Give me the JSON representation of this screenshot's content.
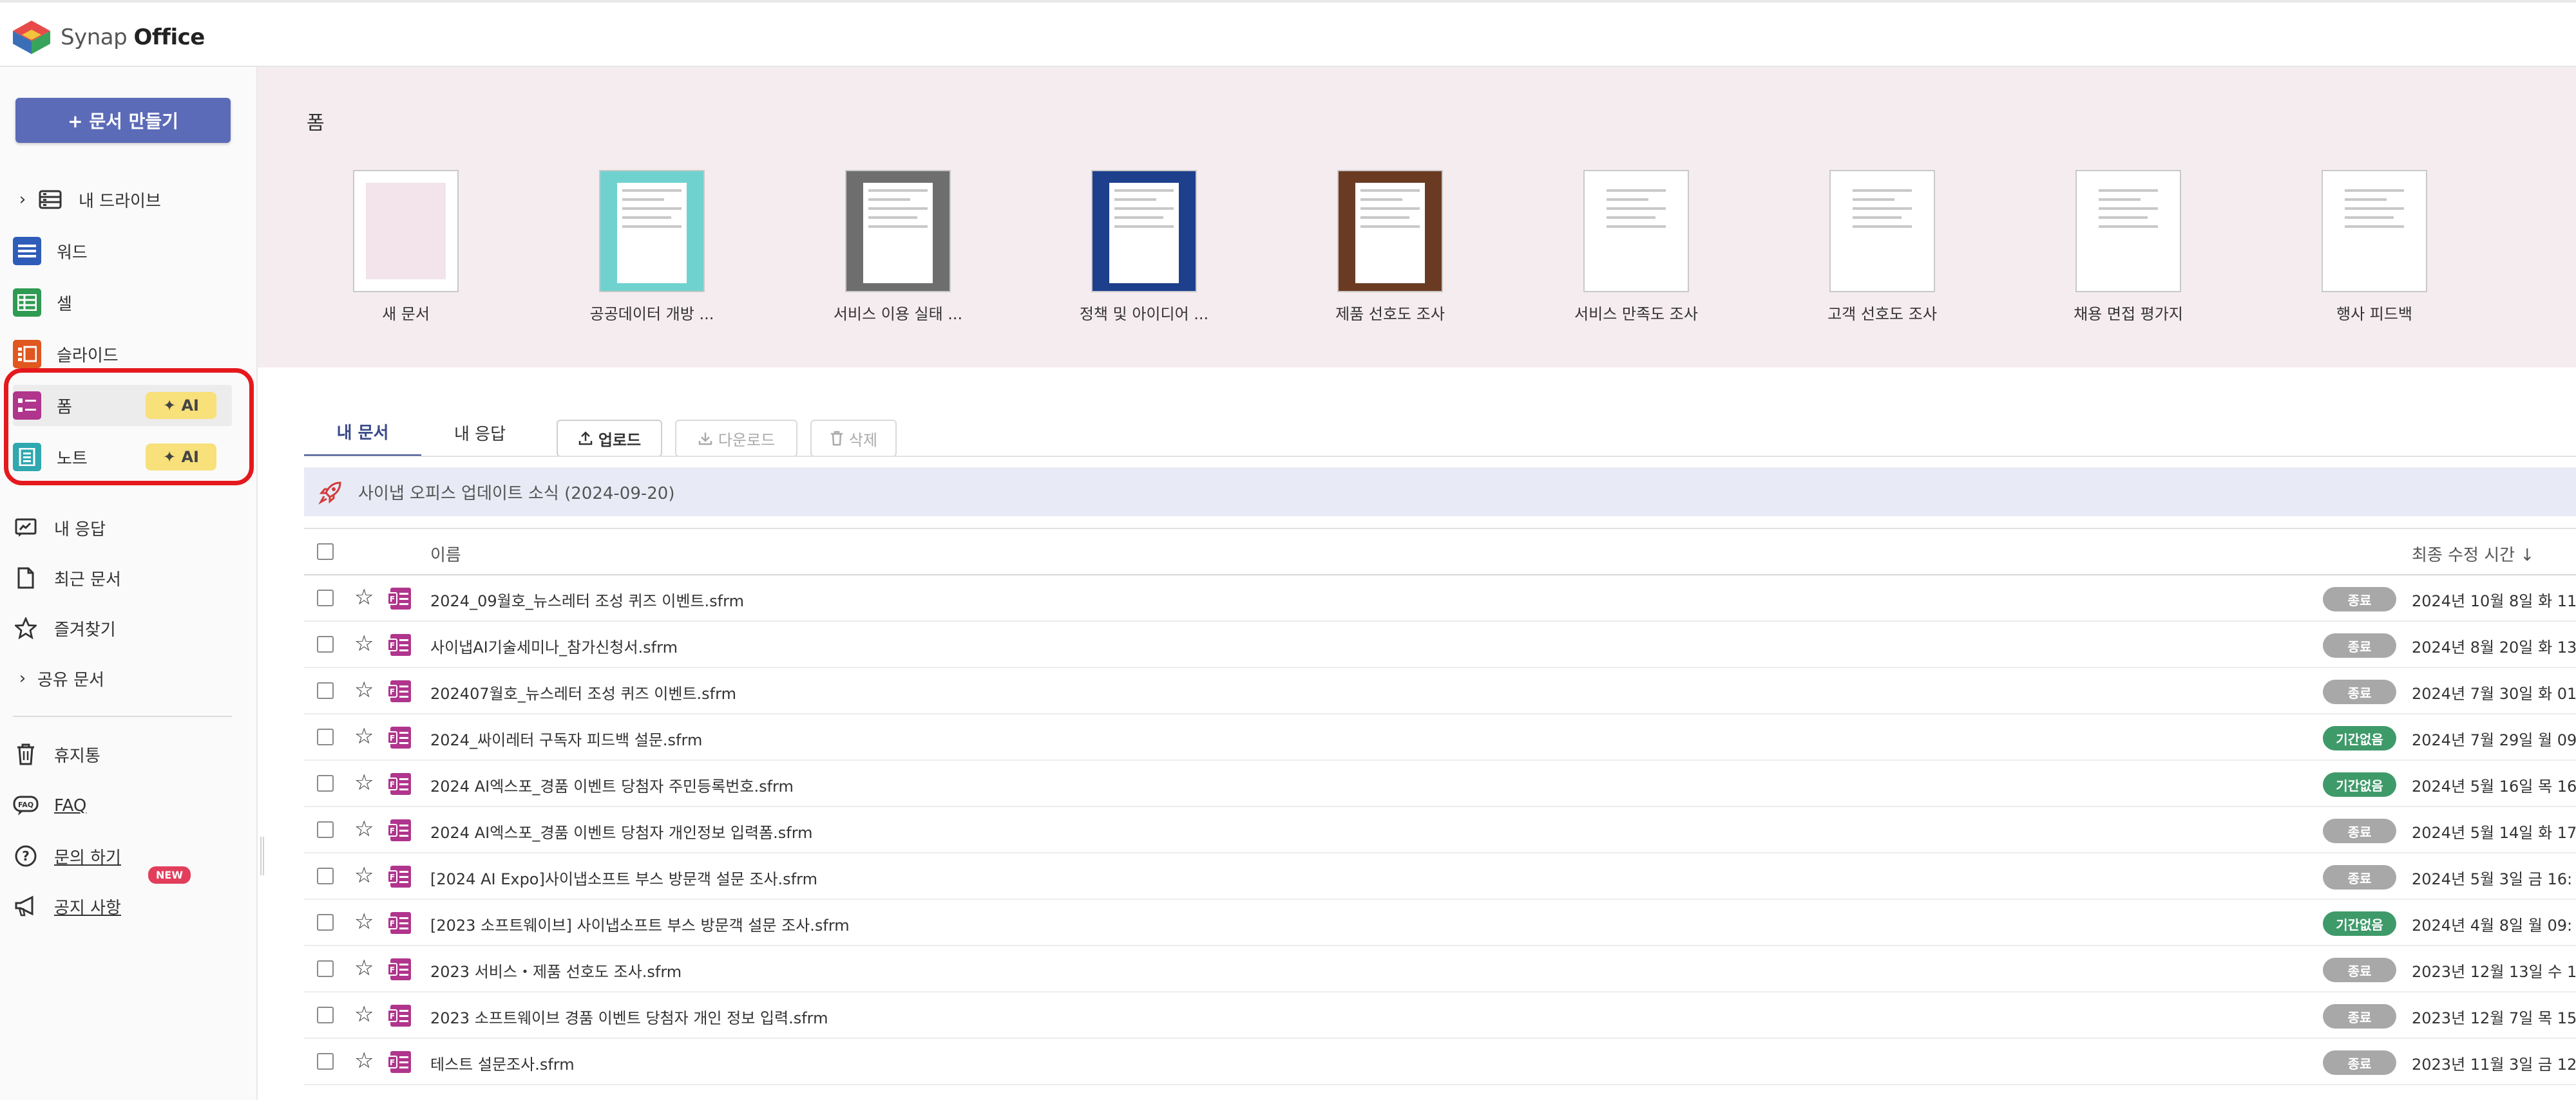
{
  "app": {
    "brand_light": "Synap ",
    "brand_bold": "Office"
  },
  "sidebar": {
    "create_label": "+ 문서 만들기",
    "items": [
      {
        "label": "내 드라이브"
      },
      {
        "label": "워드"
      },
      {
        "label": "셀"
      },
      {
        "label": "슬라이드"
      },
      {
        "label": "폼",
        "badge": "AI"
      },
      {
        "label": "노트",
        "badge": "AI"
      },
      {
        "label": "내 응답"
      },
      {
        "label": "최근 문서"
      },
      {
        "label": "즐겨찾기"
      },
      {
        "label": "공유 문서"
      },
      {
        "label": "휴지통"
      },
      {
        "label": "FAQ"
      },
      {
        "label": "문의 하기"
      },
      {
        "label": "공지 사항",
        "badge": "NEW"
      }
    ]
  },
  "templates": {
    "title": "폼",
    "items": [
      {
        "label": "새 문서"
      },
      {
        "label": "공공데이터 개방 ..."
      },
      {
        "label": "서비스 이용 실태 ..."
      },
      {
        "label": "정책 및 아이디어 ..."
      },
      {
        "label": "제품 선호도 조사"
      },
      {
        "label": "서비스 만족도 조사"
      },
      {
        "label": "고객 선호도 조사"
      },
      {
        "label": "채용 면접 평가지"
      },
      {
        "label": "행사 피드백"
      }
    ]
  },
  "tabs": [
    {
      "label": "내 문서"
    },
    {
      "label": "내 응답"
    }
  ],
  "toolbar": {
    "upload": "업로드",
    "download": "다운로드",
    "delete": "삭제"
  },
  "notice": {
    "text": "사이냅 오피스 업데이트 소식 (2024-09-20)"
  },
  "table": {
    "col_name": "이름",
    "col_time": "최종 수정 시간 ↓",
    "rows": [
      {
        "name": "2024_09월호_뉴스레터 조성 퀴즈 이벤트.sfrm",
        "status": "종료",
        "time": "2024년 10월 8일 화 11"
      },
      {
        "name": "사이냅AI기술세미나_참가신청서.sfrm",
        "status": "종료",
        "time": "2024년 8월 20일 화 13"
      },
      {
        "name": "202407월호_뉴스레터 조성 퀴즈 이벤트.sfrm",
        "status": "종료",
        "time": "2024년 7월 30일 화 01"
      },
      {
        "name": "2024_싸이레터 구독자 피드백 설문.sfrm",
        "status": "기간없음",
        "time": "2024년 7월 29일 월 09"
      },
      {
        "name": "2024 AI엑스포_경품 이벤트 당첨자 주민등록번호.sfrm",
        "status": "기간없음",
        "time": "2024년 5월 16일 목 16"
      },
      {
        "name": "2024 AI엑스포_경품 이벤트 당첨자 개인정보 입력폼.sfrm",
        "status": "종료",
        "time": "2024년 5월 14일 화 17"
      },
      {
        "name": "[2024 AI Expo]사이냅소프트 부스 방문객 설문 조사.sfrm",
        "status": "종료",
        "time": "2024년 5월 3일 금 16:"
      },
      {
        "name": "[2023 소프트웨이브] 사이냅소프트 부스 방문객 설문 조사.sfrm",
        "status": "기간없음",
        "time": "2024년 4월 8일 월 09:"
      },
      {
        "name": "2023 서비스・제품 선호도 조사.sfrm",
        "status": "종료",
        "time": "2023년 12월 13일 수 1"
      },
      {
        "name": "2023 소프트웨이브 경품 이벤트 당첨자 개인 정보 입력.sfrm",
        "status": "종료",
        "time": "2023년 12월 7일 목 15"
      },
      {
        "name": "테스트 설문조사.sfrm",
        "status": "종료",
        "time": "2023년 11월 3일 금 12"
      }
    ]
  },
  "colors": {
    "brand_button": "#5b6bb8",
    "status_ended": "#a8a8a8",
    "status_ongoing": "#3f9a6a",
    "form_icon": "#b0358c",
    "highlight": "#e5191d"
  }
}
